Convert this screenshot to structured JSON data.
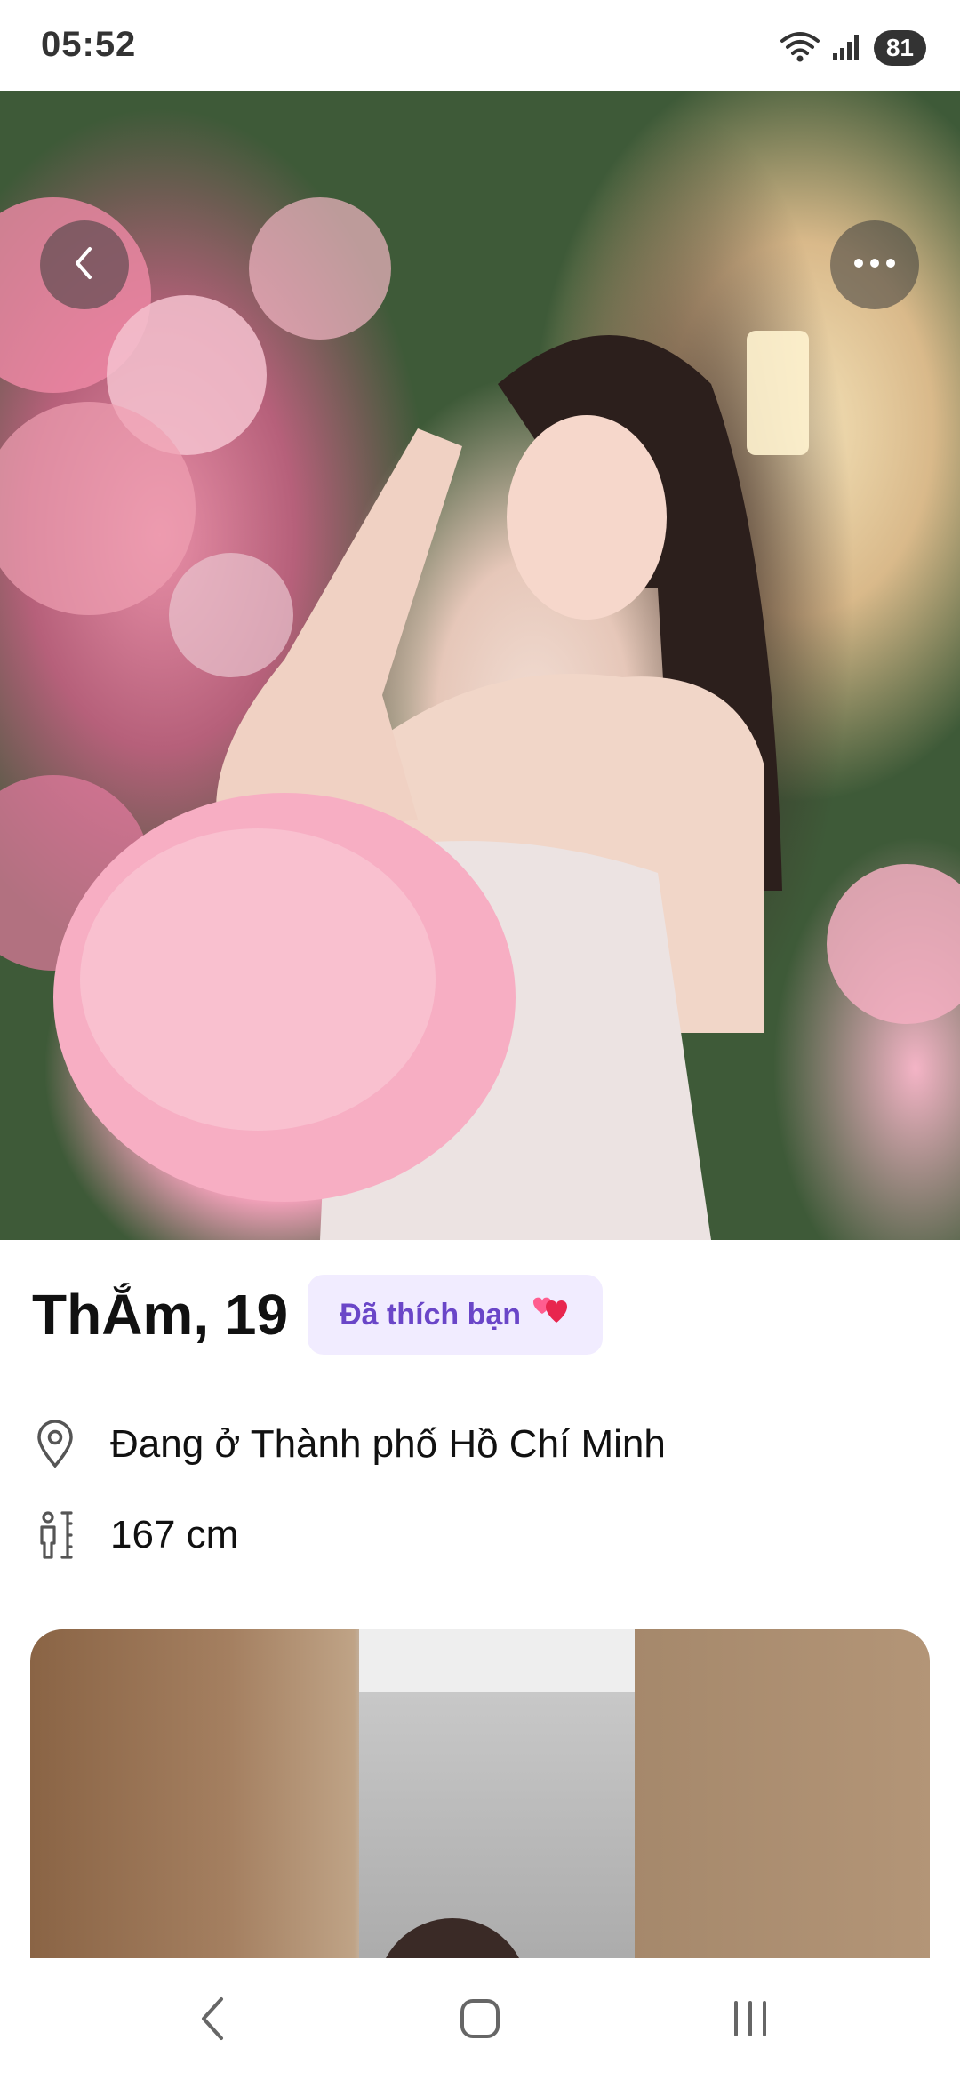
{
  "status_bar": {
    "time": "05:52",
    "battery": "81"
  },
  "hero": {
    "back_icon": "chevron-left-icon",
    "more_icon": "more-horizontal-icon"
  },
  "profile": {
    "name_age": "ThẮm, 19",
    "liked_badge": "Đã thích bạn",
    "liked_badge_icon": "two-hearts-icon",
    "location": "Đang ở Thành phố Hồ Chí Minh",
    "height": "167 cm"
  },
  "colors": {
    "accent": "#6a46c8",
    "badge_bg": "#f1ecff"
  },
  "nav_bar": {
    "icons": [
      "back-icon",
      "home-icon",
      "recents-icon"
    ]
  }
}
